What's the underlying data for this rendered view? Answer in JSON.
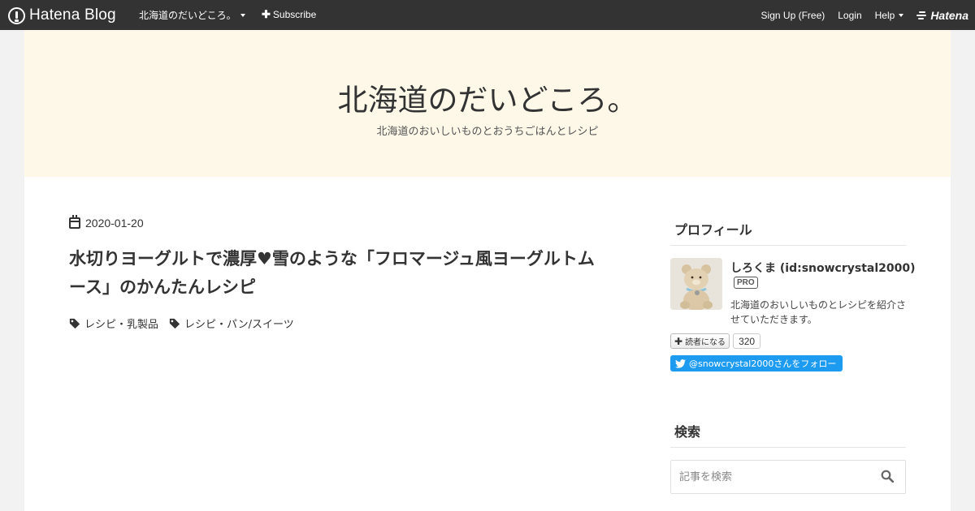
{
  "topbar": {
    "brand": "Hatena Blog",
    "blog_menu": "北海道のだいどころ。",
    "subscribe": "Subscribe",
    "signup": "Sign Up (Free)",
    "login": "Login",
    "help": "Help",
    "hatena": "Hatena"
  },
  "header": {
    "title": "北海道のだいどころ。",
    "description": "北海道のおいしいものとおうちごはんとレシピ"
  },
  "entry": {
    "date": "2020-01-20",
    "title": "水切りヨーグルトで濃厚♥雪のような「フロマージュ風ヨーグルトムース」のかんたんレシピ",
    "categories": [
      "レシピ・乳製品",
      "レシピ・パン/スイーツ"
    ]
  },
  "sidebar": {
    "profile_title": "プロフィール",
    "profile_name": "しろくま (id:snowcrystal2000)",
    "pro_badge": "PRO",
    "profile_desc": "北海道のおいしいものとレシピを紹介させていただきます。",
    "reader_button": "読者になる",
    "reader_count": "320",
    "twitter_follow": "@snowcrystal2000さんをフォロー",
    "search_title": "検索",
    "search_placeholder": "記事を検索"
  },
  "colors": {
    "topbar": "#333333",
    "header_bg": "#fdf8e8",
    "twitter": "#1d9bf0"
  }
}
